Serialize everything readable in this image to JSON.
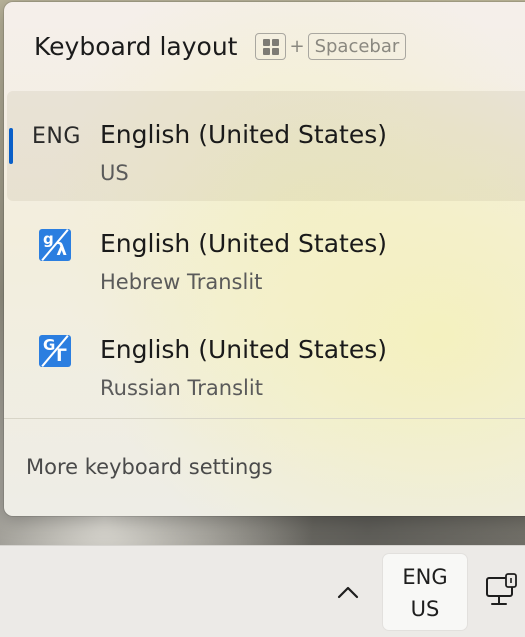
{
  "flyout": {
    "title": "Keyboard layout",
    "shortcut": {
      "key1_icon": "windows-key-icon",
      "plus": "+",
      "key2": "Spacebar"
    },
    "layouts": [
      {
        "short": "ENG",
        "name": "English (United States)",
        "sub": "US",
        "selected": true
      },
      {
        "icon": "transliteration-icon",
        "icon_top": "g",
        "icon_bottom": "λ",
        "name": "English (United States)",
        "sub": "Hebrew Translit",
        "selected": false
      },
      {
        "icon": "transliteration-icon",
        "icon_top": "G",
        "icon_bottom": "Г",
        "name": "English (United States)",
        "sub": "Russian Translit",
        "selected": false
      }
    ],
    "more_settings": "More keyboard settings"
  },
  "taskbar": {
    "chevron_icon": "chevron-up-icon",
    "input_indicator": {
      "top": "ENG",
      "bottom": "US"
    },
    "network_icon": "network-computer-icon"
  },
  "colors": {
    "accent": "#0a5fc8",
    "translit_icon": "#2b7ee0"
  }
}
